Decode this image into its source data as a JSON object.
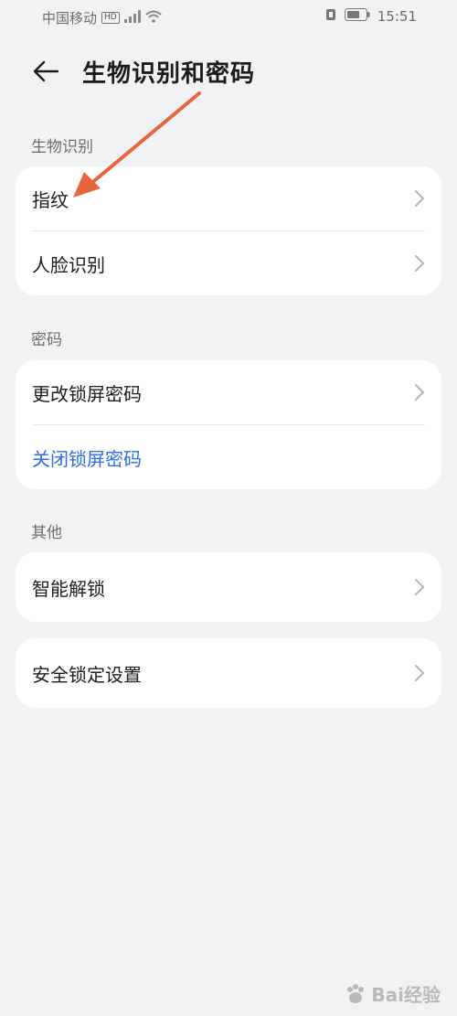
{
  "status_bar": {
    "carrier": "中国移动",
    "hd_badge": "HD",
    "time": "15:51"
  },
  "header": {
    "title": "生物识别和密码",
    "back_icon": "arrow-left-icon"
  },
  "sections": {
    "biometrics": {
      "label": "生物识别",
      "items": [
        {
          "label": "指纹",
          "icon": "chevron-right-icon"
        },
        {
          "label": "人脸识别",
          "icon": "chevron-right-icon"
        }
      ]
    },
    "password": {
      "label": "密码",
      "items": [
        {
          "label": "更改锁屏密码",
          "icon": "chevron-right-icon"
        },
        {
          "label": "关闭锁屏密码"
        }
      ]
    },
    "other": {
      "label": "其他",
      "items": [
        {
          "label": "智能解锁",
          "icon": "chevron-right-icon"
        }
      ]
    },
    "security": {
      "items": [
        {
          "label": "安全锁定设置",
          "icon": "chevron-right-icon"
        }
      ]
    }
  },
  "colors": {
    "background": "#f1f2f4",
    "card": "#ffffff",
    "link_blue": "#2f6ee0",
    "annotation_arrow": "#e8663d"
  },
  "watermark": {
    "text": "Bai经验"
  }
}
